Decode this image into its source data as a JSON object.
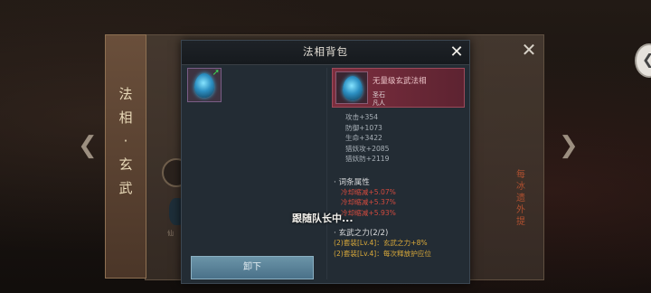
{
  "background": {
    "scroll_title": [
      "法",
      "相",
      "·",
      "玄",
      "武"
    ],
    "nav_left": "❮",
    "nav_right": "❯",
    "outer_close": "✕",
    "right_tab_glyph": "❮",
    "back_slot_label": "仙",
    "back_red_text": [
      "每",
      "冰",
      "遗",
      "外",
      "提"
    ]
  },
  "modal": {
    "title": "法相背包",
    "close": "✕",
    "selected_item": {
      "icon": "blue-egg-icon",
      "upgrade_icon": "green-up-arrow-icon"
    },
    "unequip_label": "卸下",
    "detail": {
      "name": "无量级玄武法相",
      "subtitle1": "圣石",
      "subtitle2": "凡人",
      "stats": [
        "攻击+354",
        "防御+1073",
        "生命+3422",
        "猎妖攻+2085",
        "猎妖防+2119"
      ],
      "affix_title": "· 词条属性",
      "affixes": [
        "冷却缩减+5.07%",
        "冷却缩减+5.37%",
        "冷却缩减+5.93%"
      ],
      "set_title": "· 玄武之力(2/2)",
      "set_bonuses": [
        "(2)套装[Lv.4]：玄武之力+8%",
        "(2)套装[Lv.4]：每次释放护应位"
      ]
    },
    "toast": "跟随队长中..."
  },
  "colors": {
    "rarity_bg": "#7c2e3e",
    "affix": "#d14a3e",
    "set_bonus": "#d9a93a",
    "button": "#5b829a"
  }
}
